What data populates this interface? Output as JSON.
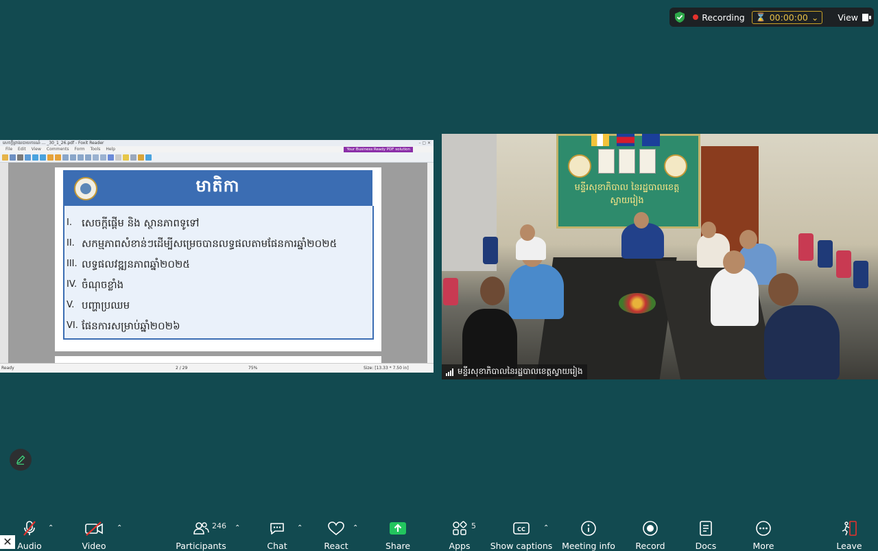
{
  "recording": {
    "label": "Recording",
    "timer": "00:00:00",
    "view_label": "View"
  },
  "shared_screen": {
    "title_bar": "សេចក្ដីព្រាងរបាយការណ៍ ... _30_1_26.pdf - Foxit Reader",
    "menu": [
      "File",
      "Edit",
      "View",
      "Comments",
      "Form",
      "Tools",
      "Help"
    ],
    "promo": "Your Business Ready PDF solution",
    "status": {
      "ready": "Ready",
      "page": "2 / 29",
      "zoom": "75%",
      "size": "Size: [13.33 * 7.50 in]"
    },
    "slide": {
      "title": "មាតិកា",
      "items": [
        {
          "num": "I.",
          "text": "សេចក្ដីផ្ដើម និង ស្ថានភាពទូទៅ"
        },
        {
          "num": "II.",
          "text": "សកម្មភាពសំខាន់ៗដើម្បីសម្រេចបានលទ្ធផលតាមផែនការឆ្នាំ២០២៥"
        },
        {
          "num": "III.",
          "text": "លទ្ធផលវឌ្ឍនភាពឆ្នាំ២០២៥"
        },
        {
          "num": "IV.",
          "text": "ចំណុចខ្លាំង"
        },
        {
          "num": "V.",
          "text": "បញ្ហាប្រឈម"
        },
        {
          "num": "VI.",
          "text": "ផែនការសម្រាប់ឆ្នាំ២០២៦"
        }
      ]
    }
  },
  "video_tile": {
    "name": "មន្ទីរសុខាភិបាលនៃរដ្ឋបាលខេត្តស្វាយរៀង",
    "banner_text": "មន្ទីរសុខាភិបាល នៃរដ្ឋបាលខេត្តស្វាយរៀង"
  },
  "toolbar": {
    "audio": "Audio",
    "video": "Video",
    "participants": "Participants",
    "participants_count": "246",
    "chat": "Chat",
    "react": "React",
    "share": "Share",
    "apps": "Apps",
    "apps_count": "5",
    "captions": "Show captions",
    "meeting_info": "Meeting info",
    "record": "Record",
    "docs": "Docs",
    "more": "More",
    "leave": "Leave"
  },
  "colors": {
    "background": "#124a50",
    "share_green": "#22c55e",
    "timer": "#e8c046",
    "slide_blue": "#3b6db3"
  }
}
